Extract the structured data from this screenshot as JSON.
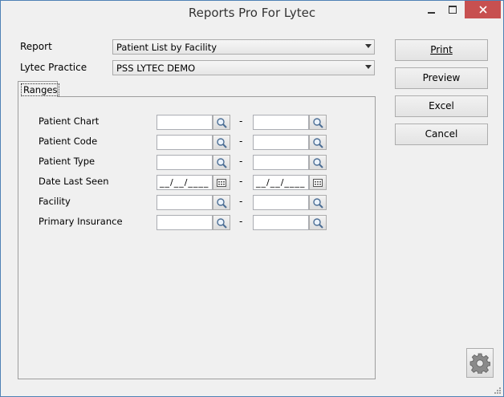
{
  "window": {
    "title": "Reports Pro For Lytec"
  },
  "form": {
    "report_label": "Report",
    "report_value": "Patient List by Facility",
    "practice_label": "Lytec Practice",
    "practice_value": "PSS LYTEC DEMO"
  },
  "tabs": {
    "active": "Ranges"
  },
  "ranges": [
    {
      "label": "Patient Chart",
      "type": "lookup",
      "from": "",
      "to": ""
    },
    {
      "label": "Patient Code",
      "type": "lookup",
      "from": "",
      "to": ""
    },
    {
      "label": "Patient Type",
      "type": "lookup",
      "from": "",
      "to": ""
    },
    {
      "label": "Date Last Seen",
      "type": "date",
      "from": "__/__/____",
      "to": "__/__/____"
    },
    {
      "label": "Facility",
      "type": "lookup",
      "from": "",
      "to": ""
    },
    {
      "label": "Primary Insurance",
      "type": "lookup",
      "from": "",
      "to": ""
    }
  ],
  "range_separator": "-",
  "buttons": {
    "print": "Print",
    "preview": "Preview",
    "excel": "Excel",
    "cancel": "Cancel"
  },
  "icons": {
    "lookup": "magnifier-icon",
    "date": "calendar-icon",
    "settings": "gear-icon"
  },
  "colors": {
    "close_button": "#c75050",
    "window_border": "#4f81b5"
  }
}
